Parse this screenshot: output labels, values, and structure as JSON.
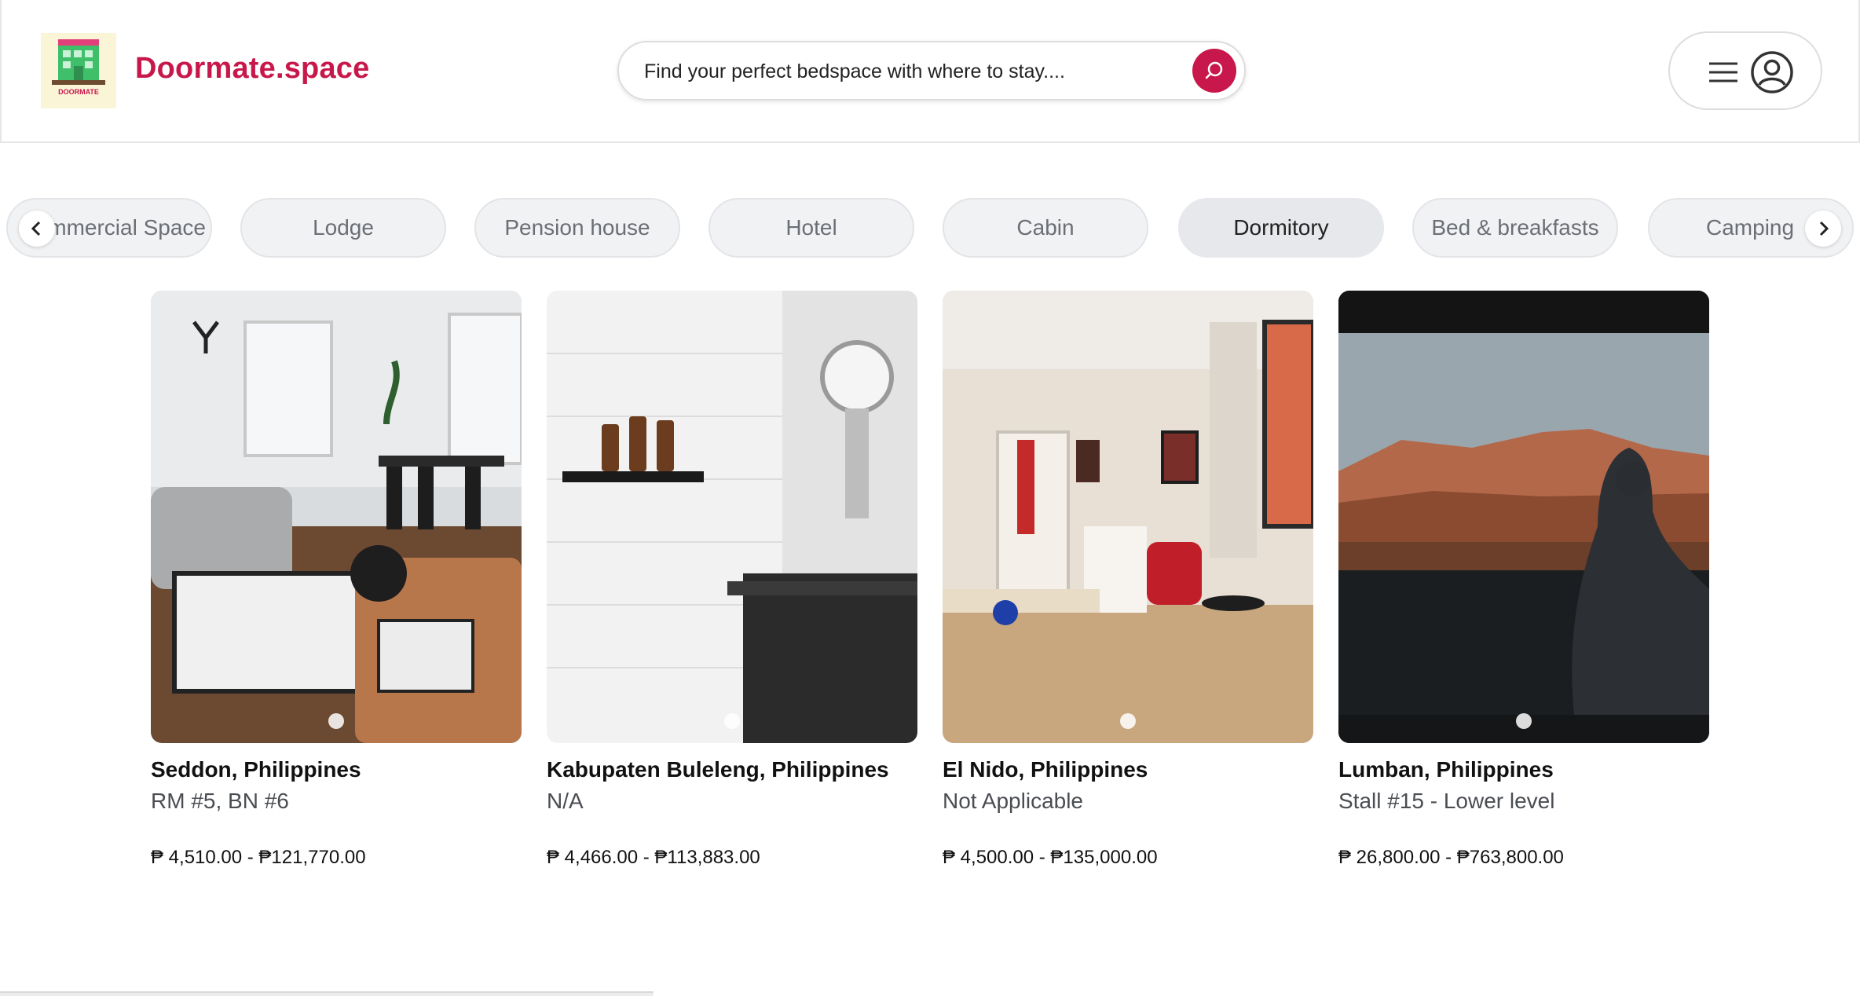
{
  "header": {
    "brand": "Doormate.space",
    "logo_text": "DOORMATE",
    "search_placeholder": "Find your perfect bedspace with where to stay....",
    "search_icon": "search-icon",
    "menu_icon": "hamburger-menu-icon",
    "profile_icon": "user-circle-icon"
  },
  "categories": {
    "items": [
      "Commercial Space",
      "Lodge",
      "Pension house",
      "Hotel",
      "Cabin",
      "Dormitory",
      "Bed & breakfasts",
      "Camping"
    ],
    "active": "Dormitory",
    "prev_icon": "chevron-left-icon",
    "next_icon": "chevron-right-icon"
  },
  "listings": [
    {
      "location": "Seddon, Philippines",
      "detail": "RM #5, BN #6",
      "price": "₱ 4,510.00 - ₱121,770.00"
    },
    {
      "location": "Kabupaten Buleleng, Philippines",
      "detail": "N/A",
      "price": "₱ 4,466.00 - ₱113,883.00"
    },
    {
      "location": "El Nido, Philippines",
      "detail": "Not Applicable",
      "price": "₱ 4,500.00 - ₱135,000.00"
    },
    {
      "location": "Lumban, Philippines",
      "detail": "Stall #15 - Lower level",
      "price": "₱ 26,800.00 - ₱763,800.00"
    }
  ],
  "colors": {
    "brand": "#c8174a",
    "chip_bg": "#f1f2f4",
    "chip_active_bg": "#e6e8eb"
  }
}
